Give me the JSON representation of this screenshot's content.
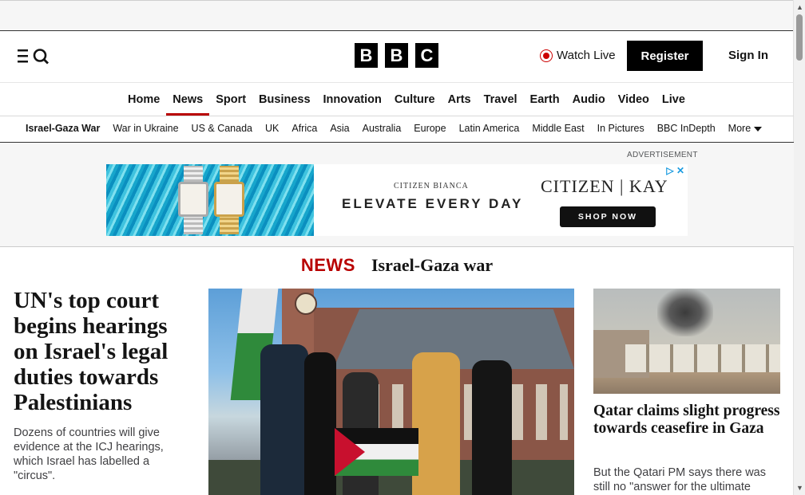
{
  "header": {
    "logo_letters": [
      "B",
      "B",
      "C"
    ],
    "watch_live": "Watch Live",
    "register": "Register",
    "sign_in": "Sign In",
    "icons": [
      "menu-icon",
      "search-icon",
      "live-icon"
    ]
  },
  "main_nav": {
    "items": [
      "Home",
      "News",
      "Sport",
      "Business",
      "Innovation",
      "Culture",
      "Arts",
      "Travel",
      "Earth",
      "Audio",
      "Video",
      "Live"
    ],
    "active": "News"
  },
  "sub_nav": {
    "items": [
      "Israel-Gaza War",
      "War in Ukraine",
      "US & Canada",
      "UK",
      "Africa",
      "Asia",
      "Australia",
      "Europe",
      "Latin America",
      "Middle East",
      "In Pictures",
      "BBC InDepth"
    ],
    "more": "More"
  },
  "advertisement": {
    "label": "ADVERTISEMENT",
    "brand_line": "CITIZEN BIANCA",
    "slogan": "ELEVATE EVERY DAY",
    "brands": "CITIZEN | KAY",
    "cta": "SHOP NOW"
  },
  "section": {
    "label": "NEWS",
    "topic": "Israel-Gaza war"
  },
  "lead_story": {
    "headline": "UN's top court begins hearings on Israel's legal duties towards Palestinians",
    "summary": "Dozens of countries will give evidence at the ICJ hearings, which Israel has labelled a \"circus\"."
  },
  "side_story": {
    "headline": "Qatar claims slight progress towards ceasefire in Gaza",
    "summary": "But the Qatari PM says there was still no \"answer for the ultimate"
  },
  "colors": {
    "accent": "#b80000",
    "live": "#cc0000",
    "text": "#141414"
  }
}
